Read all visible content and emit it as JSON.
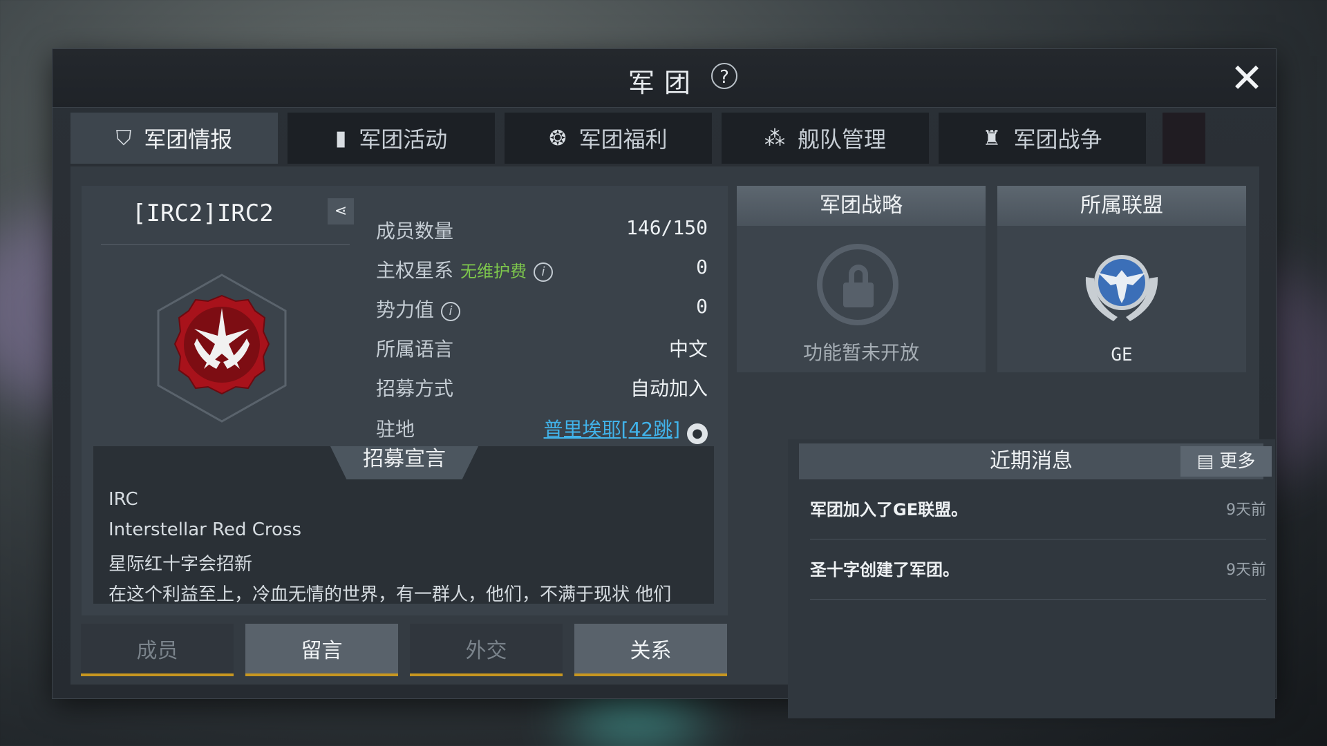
{
  "window": {
    "title": "军团",
    "help_label": "?",
    "close_label": "✕"
  },
  "tabs": [
    {
      "label": "军团情报",
      "icon": "shield-icon",
      "active": true
    },
    {
      "label": "军团活动",
      "icon": "book-icon",
      "active": false
    },
    {
      "label": "军团福利",
      "icon": "gift-icon",
      "active": false
    },
    {
      "label": "舰队管理",
      "icon": "fleet-icon",
      "active": false
    },
    {
      "label": "军团战争",
      "icon": "castle-icon",
      "active": false
    }
  ],
  "guild": {
    "name": "[IRC2]IRC2",
    "info": [
      {
        "label": "成员数量",
        "value": "146/150"
      },
      {
        "label": "主权星系",
        "tag": "无维护费",
        "value": "0"
      },
      {
        "label": "势力值",
        "value": "0"
      },
      {
        "label": "所属语言",
        "value": "中文"
      },
      {
        "label": "招募方式",
        "value": "自动加入"
      },
      {
        "label": "驻地",
        "value": "普里埃耶[42跳]"
      }
    ]
  },
  "recruit": {
    "title": "招募宣言",
    "lines": [
      "IRC",
      "Interstellar Red Cross",
      "星际红十字会招新",
      "在这个利益至上，冷血无情的世界，有一群人，他们，不满于现状 他们"
    ]
  },
  "bottom_buttons": [
    {
      "label": "成员",
      "active": false
    },
    {
      "label": "留言",
      "active": true
    },
    {
      "label": "外交",
      "active": false
    },
    {
      "label": "关系",
      "active": true
    }
  ],
  "strategy": {
    "title": "军团战略",
    "status": "功能暂未开放"
  },
  "alliance": {
    "title": "所属联盟",
    "name": "GE"
  },
  "news": {
    "title": "近期消息",
    "more_label": "更多",
    "items": [
      {
        "text": "军团加入了GE联盟。",
        "time": "9天前"
      },
      {
        "text": "圣十字创建了军团。",
        "time": "9天前"
      }
    ]
  },
  "colors": {
    "accent_gold": "#c79620",
    "link_blue": "#41b3ea",
    "tag_green": "#7ec84c",
    "emblem_red": "#a8121b"
  }
}
